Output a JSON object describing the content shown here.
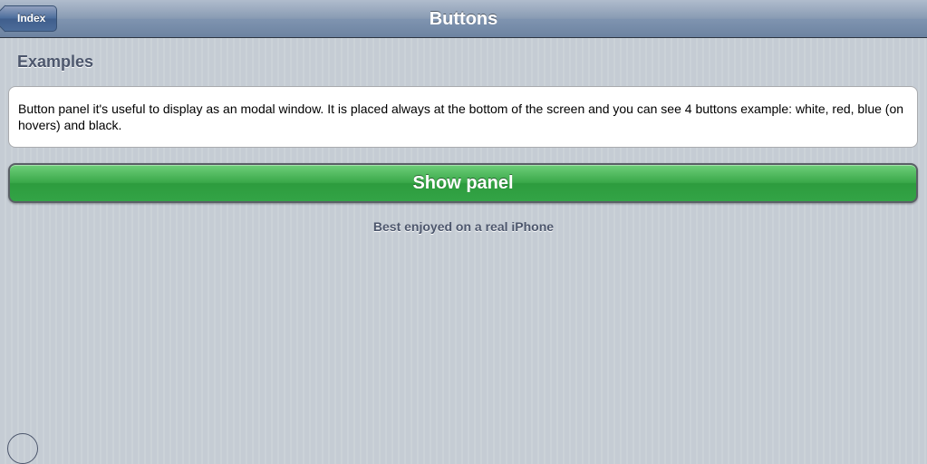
{
  "toolbar": {
    "title": "Buttons",
    "back_label": "Index"
  },
  "content": {
    "section_title": "Examples",
    "description": "Button panel it's useful to display as an modal window. It is placed always at the bottom of the screen and you can see 4 buttons example: white, red, blue (on hovers) and black.",
    "show_panel_label": "Show panel",
    "footer_note": "Best enjoyed on a real iPhone"
  },
  "colors": {
    "toolbar": "#6d83a1",
    "button_green": "#3aa84a",
    "section_text": "#4c566c",
    "background": "#c5ccd4"
  }
}
